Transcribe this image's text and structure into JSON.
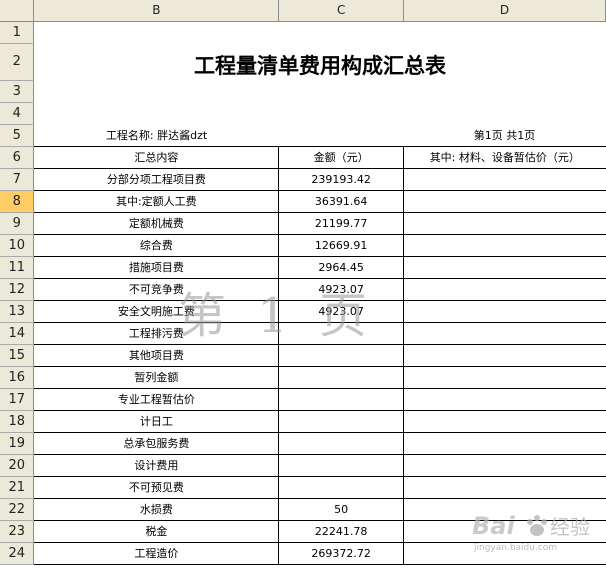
{
  "columns": [
    "B",
    "C",
    "D"
  ],
  "row_numbers": [
    "1",
    "2",
    "3",
    "4",
    "5",
    "6",
    "7",
    "8",
    "9",
    "10",
    "11",
    "12",
    "13",
    "14",
    "15",
    "16",
    "17",
    "18",
    "19",
    "20",
    "21",
    "22",
    "23",
    "24"
  ],
  "selected_row": "8",
  "title": "工程量清单费用构成汇总表",
  "project_name": "工程名称: 胖达酱dzt",
  "page_info": "第1页 共1页",
  "headers": {
    "b": "汇总内容",
    "c": "金额（元）",
    "d": "其中: 材料、设备暂估价（元）"
  },
  "rows": [
    {
      "item": "分部分项工程项目费",
      "amount": "239193.42"
    },
    {
      "item": "其中:定额人工费",
      "amount": "36391.64"
    },
    {
      "item": "定额机械费",
      "amount": "21199.77"
    },
    {
      "item": "综合费",
      "amount": "12669.91"
    },
    {
      "item": "措施项目费",
      "amount": "2964.45"
    },
    {
      "item": "不可竞争费",
      "amount": "4923.07"
    },
    {
      "item": "安全文明施工费",
      "amount": "4923.07"
    },
    {
      "item": "工程排污费",
      "amount": ""
    },
    {
      "item": "其他项目费",
      "amount": ""
    },
    {
      "item": "暂列金额",
      "amount": ""
    },
    {
      "item": "专业工程暂估价",
      "amount": ""
    },
    {
      "item": "计日工",
      "amount": ""
    },
    {
      "item": "总承包服务费",
      "amount": ""
    },
    {
      "item": "设计费用",
      "amount": ""
    },
    {
      "item": "不可预见费",
      "amount": ""
    },
    {
      "item": "水损费",
      "amount": "50"
    },
    {
      "item": "税金",
      "amount": "22241.78"
    },
    {
      "item": "工程造价",
      "amount": "269372.72"
    }
  ],
  "watermark": "第 1 页",
  "logo_text": "Bai du 经验",
  "logo_url_text": "jingyan.baidu.com"
}
